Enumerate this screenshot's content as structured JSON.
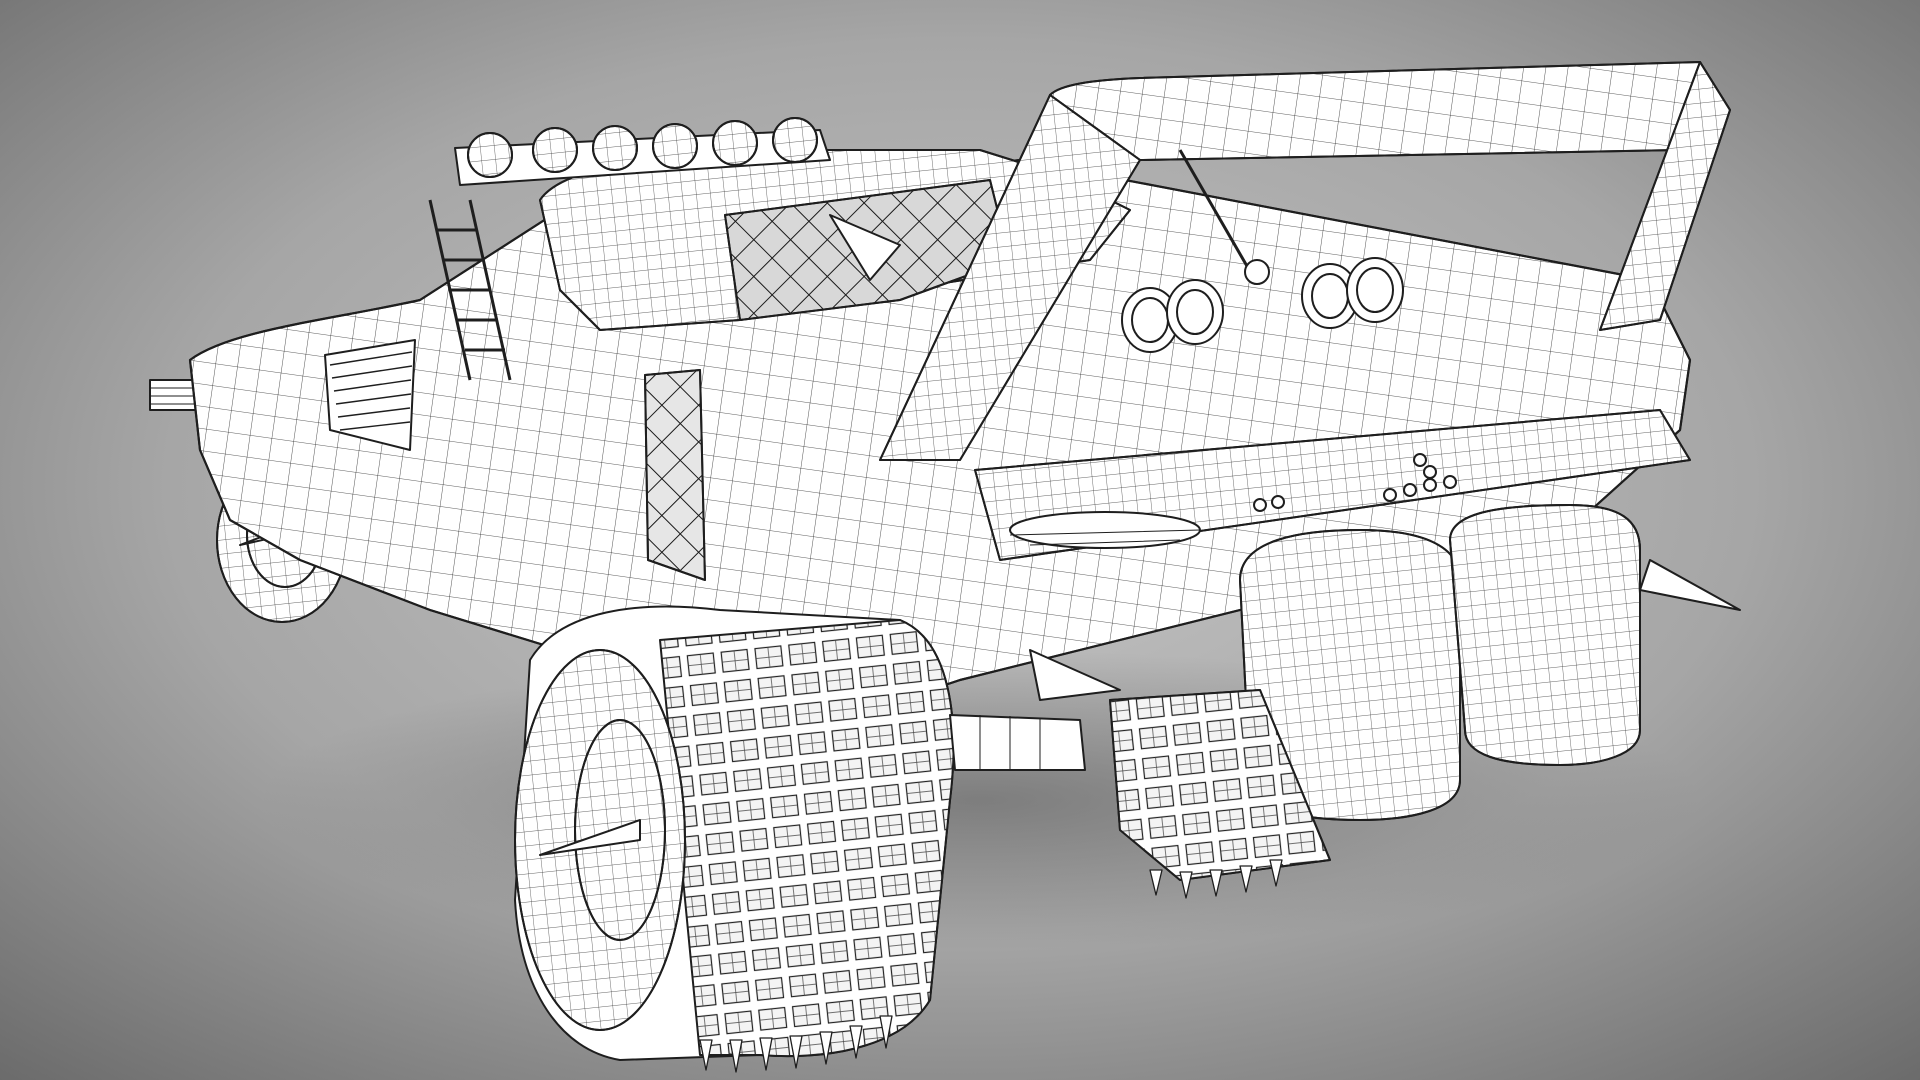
{
  "scene": {
    "subject": "wireframe-render-armored-muscle-car",
    "background_center_color": "#bdbdbd",
    "background_edge_color": "#6e6e6e",
    "shadow_color": "#5a5a5a",
    "model_fill_color": "#ffffff",
    "wire_color": "#1e1e1e",
    "mesh_net_color": "#3a3a3a"
  }
}
